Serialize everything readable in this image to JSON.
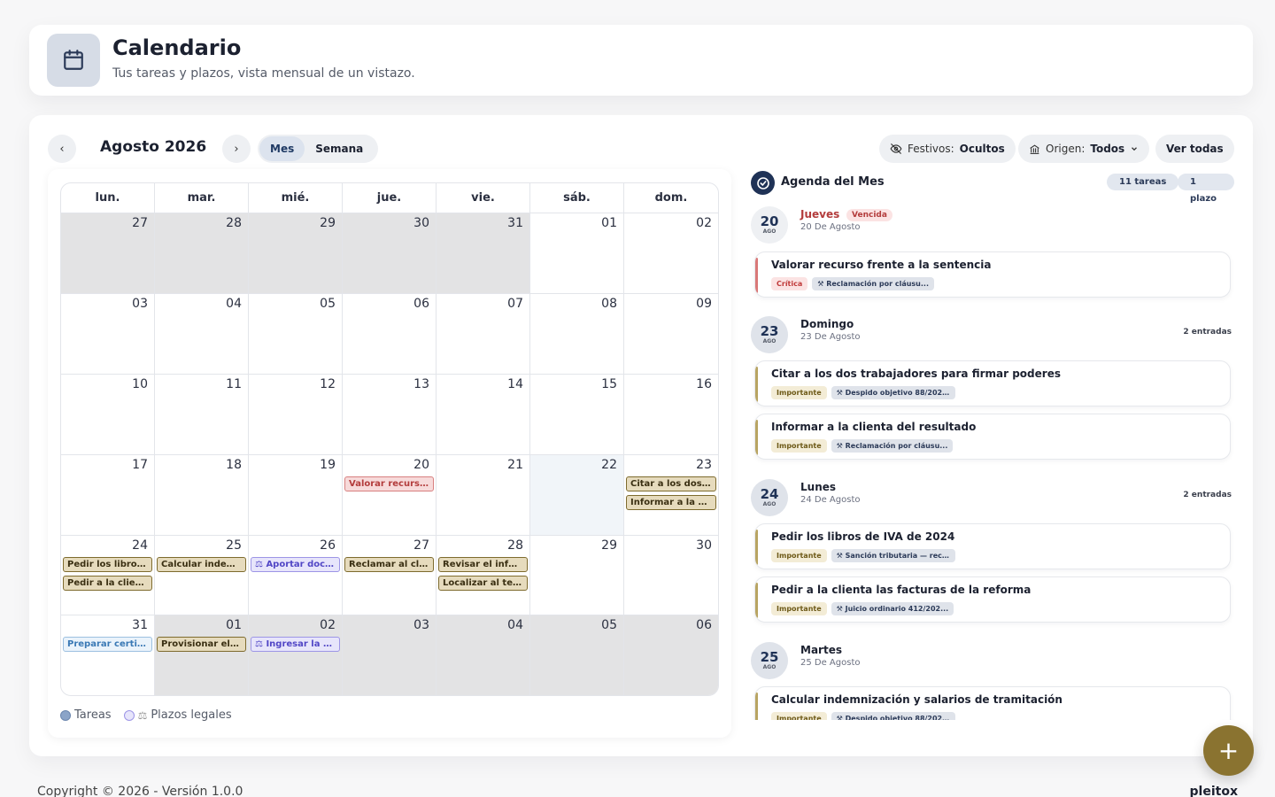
{
  "header": {
    "title": "Calendario",
    "subtitle": "Tus tareas y plazos, vista mensual de un vistazo."
  },
  "toolbar": {
    "prev": "‹",
    "next": "›",
    "month_title": "Agosto 2026",
    "view_month": "Mes",
    "view_week": "Semana",
    "holidays_label": "Festivos:",
    "holidays_value": "Ocultos",
    "origin_label": "Origen:",
    "origin_value": "Todos",
    "view_all": "Ver todas"
  },
  "calendar": {
    "weekdays": [
      "lun.",
      "mar.",
      "mié.",
      "jue.",
      "vie.",
      "sáb.",
      "dom."
    ],
    "weeks": [
      [
        {
          "n": "27",
          "other": true
        },
        {
          "n": "28",
          "other": true
        },
        {
          "n": "29",
          "other": true
        },
        {
          "n": "30",
          "other": true
        },
        {
          "n": "31",
          "other": true
        },
        {
          "n": "01"
        },
        {
          "n": "02"
        }
      ],
      [
        {
          "n": "03"
        },
        {
          "n": "04"
        },
        {
          "n": "05"
        },
        {
          "n": "06"
        },
        {
          "n": "07"
        },
        {
          "n": "08"
        },
        {
          "n": "09"
        }
      ],
      [
        {
          "n": "10"
        },
        {
          "n": "11"
        },
        {
          "n": "12"
        },
        {
          "n": "13"
        },
        {
          "n": "14"
        },
        {
          "n": "15"
        },
        {
          "n": "16"
        }
      ],
      [
        {
          "n": "17"
        },
        {
          "n": "18"
        },
        {
          "n": "19"
        },
        {
          "n": "20",
          "events": [
            {
              "t": "Valorar recurso f...",
              "c": "red"
            }
          ]
        },
        {
          "n": "21"
        },
        {
          "n": "22",
          "today": true
        },
        {
          "n": "23",
          "events": [
            {
              "t": "Citar a los dos tr...",
              "c": "gold"
            },
            {
              "t": "Informar a la clie...",
              "c": "gold"
            }
          ]
        }
      ],
      [
        {
          "n": "24",
          "events": [
            {
              "t": "Pedir los libros d...",
              "c": "gold"
            },
            {
              "t": "Pedir a la clienta...",
              "c": "gold"
            }
          ]
        },
        {
          "n": "25",
          "events": [
            {
              "t": "Calcular indemn...",
              "c": "gold"
            }
          ]
        },
        {
          "n": "26",
          "events": [
            {
              "t": "⚖ Aportar docu...",
              "c": "purple"
            }
          ]
        },
        {
          "n": "27",
          "events": [
            {
              "t": "Reclamar al clie...",
              "c": "gold"
            }
          ]
        },
        {
          "n": "28",
          "events": [
            {
              "t": "Revisar el inform...",
              "c": "gold"
            },
            {
              "t": "Localizar al testi...",
              "c": "gold"
            }
          ]
        },
        {
          "n": "29"
        },
        {
          "n": "30"
        }
      ],
      [
        {
          "n": "31",
          "events": [
            {
              "t": "Preparar certific...",
              "c": "blue"
            }
          ]
        },
        {
          "n": "01",
          "other": true,
          "events": [
            {
              "t": "Provisionar el pa...",
              "c": "gold"
            }
          ]
        },
        {
          "n": "02",
          "other": true,
          "events": [
            {
              "t": "⚖ Ingresar la de...",
              "c": "purple"
            }
          ]
        },
        {
          "n": "03",
          "other": true
        },
        {
          "n": "04",
          "other": true
        },
        {
          "n": "05",
          "other": true
        },
        {
          "n": "06",
          "other": true
        }
      ]
    ]
  },
  "legend": {
    "tasks": "Tareas",
    "deadlines_icon": "⚖",
    "deadlines": "Plazos legales"
  },
  "agenda": {
    "title": "Agenda del Mes",
    "tasks_count": "11 tareas",
    "deadlines_count": "1 plazo",
    "groups": [
      {
        "day": "20",
        "mon": "AGO",
        "name": "Jueves",
        "date": "20 De Agosto",
        "badge": "Vencida",
        "count": "",
        "items": [
          {
            "title": "Valorar recurso frente a la sentencia",
            "priority": "Crítica",
            "case": "⚒ Reclamación por cláusu..."
          }
        ]
      },
      {
        "day": "23",
        "mon": "AGO",
        "name": "Domingo",
        "date": "23 De Agosto",
        "badge": "",
        "count": "2 entradas",
        "items": [
          {
            "title": "Citar a los dos trabajadores para firmar poderes",
            "priority": "Importante",
            "case": "⚒ Despido objetivo 88/202..."
          },
          {
            "title": "Informar a la clienta del resultado",
            "priority": "Importante",
            "case": "⚒ Reclamación por cláusu..."
          }
        ]
      },
      {
        "day": "24",
        "mon": "AGO",
        "name": "Lunes",
        "date": "24 De Agosto",
        "badge": "",
        "count": "2 entradas",
        "items": [
          {
            "title": "Pedir los libros de IVA de 2024",
            "priority": "Importante",
            "case": "⚒ Sanción tributaria — rec..."
          },
          {
            "title": "Pedir a la clienta las facturas de la reforma",
            "priority": "Importante",
            "case": "⚒ Juicio ordinario 412/202..."
          }
        ]
      },
      {
        "day": "25",
        "mon": "AGO",
        "name": "Martes",
        "date": "25 De Agosto",
        "badge": "",
        "count": "",
        "items": [
          {
            "title": "Calcular indemnización y salarios de tramitación",
            "priority": "Importante",
            "case": "⚒ Despido objetivo 88/202..."
          }
        ]
      }
    ]
  },
  "fab": "+",
  "footer": {
    "copyright": "Copyright © 2026 - Versión 1.0.0",
    "brand": "pleitox"
  },
  "colors": {
    "accent": "#8a7330",
    "navy": "#1f3256",
    "critical": "#c03a3a"
  }
}
